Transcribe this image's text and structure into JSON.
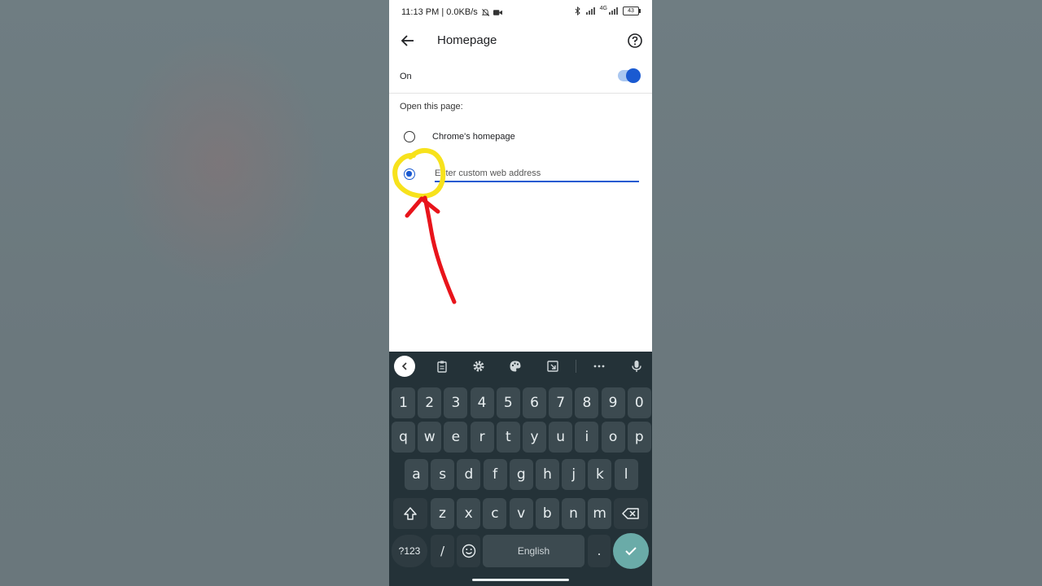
{
  "status_bar": {
    "time_and_speed": "11:13 PM | 0.0KB/s",
    "network": "4G",
    "battery": "43"
  },
  "app_bar": {
    "title": "Homepage",
    "back_icon": "arrow-left-icon",
    "help_icon": "help-circle-icon"
  },
  "toggle": {
    "label": "On",
    "state": "on"
  },
  "section": {
    "label": "Open this page:"
  },
  "options": [
    {
      "label": "Chrome's homepage",
      "selected": false
    },
    {
      "placeholder": "Enter custom web address",
      "selected": true
    }
  ],
  "keyboard": {
    "toolbar_icons": [
      "chevron-left-icon",
      "clipboard-icon",
      "gear-icon",
      "palette-icon",
      "resize-icon",
      "more-icon",
      "mic-icon"
    ],
    "number_row": [
      "1",
      "2",
      "3",
      "4",
      "5",
      "6",
      "7",
      "8",
      "9",
      "0"
    ],
    "row1": [
      "q",
      "w",
      "e",
      "r",
      "t",
      "y",
      "u",
      "i",
      "o",
      "p"
    ],
    "row2": [
      "a",
      "s",
      "d",
      "f",
      "g",
      "h",
      "j",
      "k",
      "l"
    ],
    "row3": [
      "z",
      "x",
      "c",
      "v",
      "b",
      "n",
      "m"
    ],
    "symbols_label": "?123",
    "slash_label": "/",
    "space_label": "English",
    "period_label": "."
  },
  "colors": {
    "accent": "#1a5ad1",
    "keyboard_bg": "#243238",
    "key_bg": "#3c4a50",
    "enter_bg": "#6aaba8",
    "annotation_yellow": "#f7e21c",
    "annotation_red": "#e8141b"
  }
}
